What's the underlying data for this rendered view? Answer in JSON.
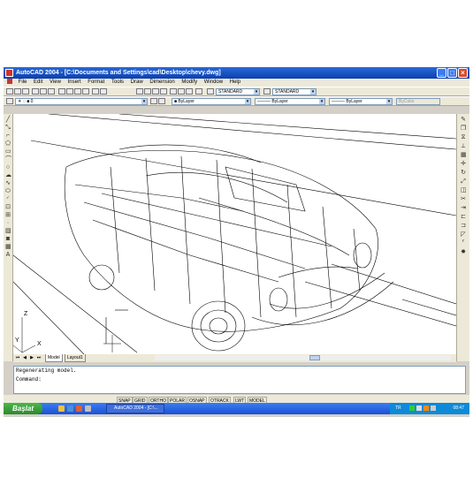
{
  "window": {
    "title": "AutoCAD 2004 - [C:\\Documents and Settings\\cad\\Desktop\\chevy.dwg]"
  },
  "menu": [
    "File",
    "Edit",
    "View",
    "Insert",
    "Format",
    "Tools",
    "Draw",
    "Dimension",
    "Modify",
    "Window",
    "Help"
  ],
  "styles": {
    "text_style": "STANDARD",
    "dim_style": "STANDARD"
  },
  "properties": {
    "layer": "0",
    "color": "ByLayer",
    "linetype": "ByLayer",
    "lineweight": "ByLayer",
    "plotstyle": "ByColor"
  },
  "tabs": [
    "Model",
    "Layout1"
  ],
  "command_lines": [
    "Regenerating model.",
    "Command:"
  ],
  "status_buttons": [
    "SNAP",
    "GRID",
    "ORTHO",
    "POLAR",
    "OSNAP",
    "OTRACK",
    "LWT",
    "MODEL"
  ],
  "taskbar": {
    "start": "Başlat",
    "task": "AutoCAD 2004 - [C:\\...",
    "tray_lang": "TR",
    "clock": "08:47"
  },
  "ucs": {
    "x": "X",
    "y": "Y",
    "z": "Z"
  }
}
